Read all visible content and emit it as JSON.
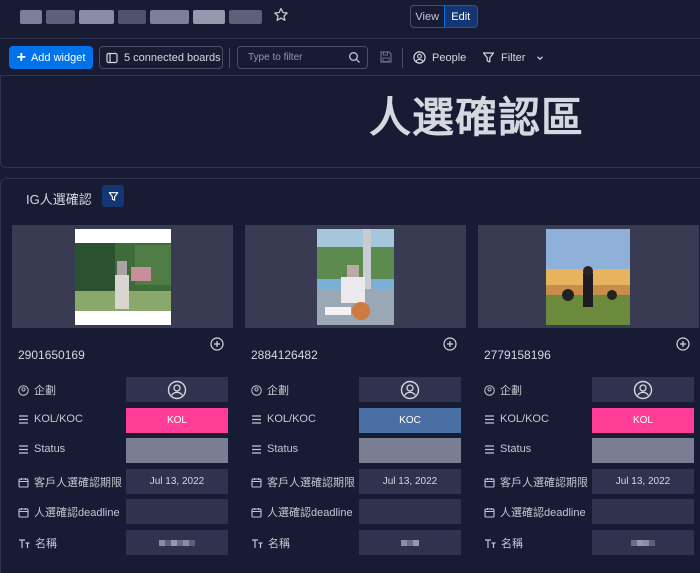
{
  "header": {
    "star_icon": "star-icon",
    "view_label": "View",
    "edit_label": "Edit",
    "active_mode": "Edit"
  },
  "toolbar": {
    "add_widget_label": "Add widget",
    "connected_boards_label": "5 connected boards",
    "filter_placeholder": "Type to filter",
    "people_label": "People",
    "filter_label": "Filter"
  },
  "hero": {
    "title": "人選確認區"
  },
  "section": {
    "title": "IG人選確認"
  },
  "field_labels": {
    "planner": "企劃",
    "kol_koc": "KOL/KOC",
    "status": "Status",
    "client_deadline": "客戶人選確認期限",
    "deadline": "人選確認deadline",
    "name": "名稱"
  },
  "cards": [
    {
      "id": "2901650169",
      "type": "KOL",
      "client_deadline": "Jul 13, 2022",
      "deadline": "",
      "status": ""
    },
    {
      "id": "2884126482",
      "type": "KOC",
      "client_deadline": "Jul 13, 2022",
      "deadline": "",
      "status": ""
    },
    {
      "id": "2779158196",
      "type": "KOL",
      "client_deadline": "Jul 13, 2022",
      "deadline": "",
      "status": ""
    }
  ],
  "colors": {
    "background": "#181b34",
    "accent": "#0073ea",
    "kol": "#ff3d96",
    "koc": "#4a6fa5",
    "status_empty": "#797e93"
  }
}
